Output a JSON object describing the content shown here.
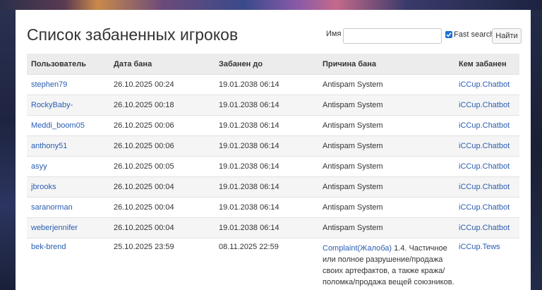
{
  "page": {
    "title": "Список забаненных игроков",
    "search_label": "Имя",
    "search_value": "",
    "fast_search_label": "Fast search",
    "fast_search_checked": true,
    "find_button": "Найти"
  },
  "table": {
    "headers": [
      "Пользователь",
      "Дата бана",
      "Забанен до",
      "Причина бана",
      "Кем забанен"
    ],
    "rows": [
      {
        "user": "stephen79",
        "date": "26.10.2025 00:24",
        "until": "19.01.2038 06:14",
        "reason": "Antispam System",
        "by": "iCCup.Chatbot"
      },
      {
        "user": "RockyBaby-",
        "date": "26.10.2025 00:18",
        "until": "19.01.2038 06:14",
        "reason": "Antispam System",
        "by": "iCCup.Chatbot"
      },
      {
        "user": "Meddi_boom05",
        "date": "26.10.2025 00:06",
        "until": "19.01.2038 06:14",
        "reason": "Antispam System",
        "by": "iCCup.Chatbot"
      },
      {
        "user": "anthony51",
        "date": "26.10.2025 00:06",
        "until": "19.01.2038 06:14",
        "reason": "Antispam System",
        "by": "iCCup.Chatbot"
      },
      {
        "user": "asyy",
        "date": "26.10.2025 00:05",
        "until": "19.01.2038 06:14",
        "reason": "Antispam System",
        "by": "iCCup.Chatbot"
      },
      {
        "user": "jbrooks",
        "date": "26.10.2025 00:04",
        "until": "19.01.2038 06:14",
        "reason": "Antispam System",
        "by": "iCCup.Chatbot"
      },
      {
        "user": "saranorman",
        "date": "26.10.2025 00:04",
        "until": "19.01.2038 06:14",
        "reason": "Antispam System",
        "by": "iCCup.Chatbot"
      },
      {
        "user": "weberjennifer",
        "date": "26.10.2025 00:04",
        "until": "19.01.2038 06:14",
        "reason": "Antispam System",
        "by": "iCCup.Chatbot"
      },
      {
        "user": "bek-brend",
        "date": "25.10.2025 23:59",
        "until": "08.11.2025 22:59",
        "reason_link": "Complaint(Жалоба)",
        "reason_text": " 1.4. Частичное или полное разрушение/продажа своих артефактов, а также кража/поломка/продажа вещей союзников.",
        "by": "iCCup.Tews"
      }
    ]
  },
  "colors": {
    "link": "#2a5db0",
    "header_bg": "#ececec",
    "checkbox": "#1e6fd9"
  }
}
